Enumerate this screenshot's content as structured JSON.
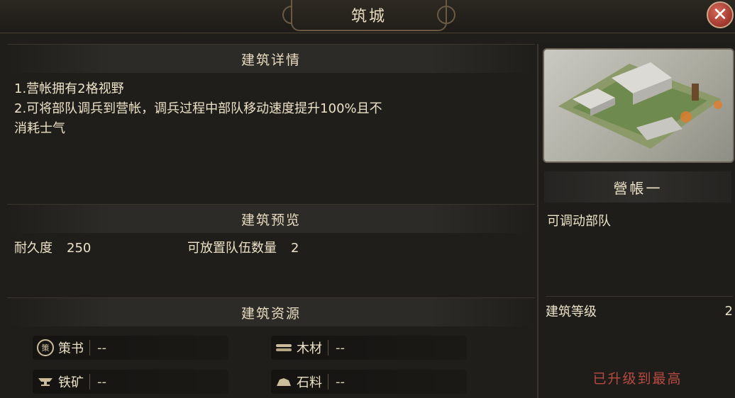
{
  "window": {
    "title": "筑城",
    "close_icon": "close-icon"
  },
  "details": {
    "heading": "建筑详情",
    "lines": [
      "1.营帐拥有2格视野",
      "2.可将部队调兵到营帐，调兵过程中部队移动速度提升100%且不",
      "消耗士气"
    ]
  },
  "preview": {
    "heading": "建筑预览",
    "durability_label": "耐久度",
    "durability_value": "250",
    "troops_label": "可放置队伍数量",
    "troops_value": "2"
  },
  "resources": {
    "heading": "建筑资源",
    "items": [
      {
        "icon": "strategy-book-icon",
        "icon_text": "策",
        "name": "策书",
        "value": "--"
      },
      {
        "icon": "wood-icon",
        "name": "木材",
        "value": "--"
      },
      {
        "icon": "iron-anvil-icon",
        "name": "铁矿",
        "value": "--"
      },
      {
        "icon": "stone-icon",
        "name": "石料",
        "value": "--"
      }
    ]
  },
  "building": {
    "name": "營帳一",
    "description": "可调动部队",
    "level_label": "建筑等级",
    "level_value": "2",
    "status": "已升级到最高"
  }
}
